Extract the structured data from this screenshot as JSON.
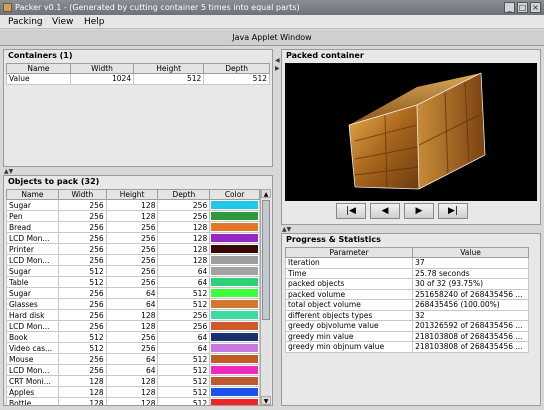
{
  "window": {
    "title": "Packer v0.1 - (Generated by cutting container 5 times into equal parts)",
    "min": "_",
    "max": "□",
    "close": "×"
  },
  "menu": [
    "Packing",
    "View",
    "Help"
  ],
  "applet_label": "Java Applet Window",
  "containers": {
    "title": "Containers (1)",
    "columns": [
      "Name",
      "Width",
      "Height",
      "Depth"
    ],
    "rows": [
      [
        "Value",
        "1024",
        "512",
        "512"
      ]
    ]
  },
  "objects": {
    "title": "Objects to pack (32)",
    "columns": [
      "Name",
      "Width",
      "Height",
      "Depth",
      "Color"
    ],
    "rows": [
      {
        "name": "Sugar",
        "w": "256",
        "h": "128",
        "d": "256",
        "color": "#1ec8e6"
      },
      {
        "name": "Pen",
        "w": "256",
        "h": "128",
        "d": "256",
        "color": "#2e9a3c"
      },
      {
        "name": "Bread",
        "w": "256",
        "h": "256",
        "d": "128",
        "color": "#e07828"
      },
      {
        "name": "LCD Mon...",
        "w": "256",
        "h": "256",
        "d": "128",
        "color": "#9628c8"
      },
      {
        "name": "Printer",
        "w": "256",
        "h": "256",
        "d": "128",
        "color": "#3a0606"
      },
      {
        "name": "LCD Mon...",
        "w": "256",
        "h": "256",
        "d": "128",
        "color": "#9e9e9e"
      },
      {
        "name": "Sugar",
        "w": "512",
        "h": "256",
        "d": "64",
        "color": "#a2a2a2"
      },
      {
        "name": "Table",
        "w": "512",
        "h": "256",
        "d": "64",
        "color": "#2ed078"
      },
      {
        "name": "Sugar",
        "w": "256",
        "h": "64",
        "d": "512",
        "color": "#3aff3a"
      },
      {
        "name": "Glasses",
        "w": "256",
        "h": "64",
        "d": "512",
        "color": "#d27830"
      },
      {
        "name": "Hard disk",
        "w": "256",
        "h": "128",
        "d": "256",
        "color": "#3adca0"
      },
      {
        "name": "LCD Mon...",
        "w": "256",
        "h": "128",
        "d": "256",
        "color": "#d05a2e"
      },
      {
        "name": "Book",
        "w": "512",
        "h": "256",
        "d": "64",
        "color": "#1a3070"
      },
      {
        "name": "Video cas...",
        "w": "512",
        "h": "256",
        "d": "64",
        "color": "#c878e0"
      },
      {
        "name": "Mouse",
        "w": "256",
        "h": "64",
        "d": "512",
        "color": "#c25a2a"
      },
      {
        "name": "LCD Mon...",
        "w": "256",
        "h": "64",
        "d": "512",
        "color": "#ee28c0"
      },
      {
        "name": "CRT Moni...",
        "w": "128",
        "h": "128",
        "d": "512",
        "color": "#be5a30"
      },
      {
        "name": "Apples",
        "w": "128",
        "h": "128",
        "d": "512",
        "color": "#1e50ee"
      },
      {
        "name": "Bottle",
        "w": "128",
        "h": "128",
        "d": "512",
        "color": "#ee2828"
      }
    ]
  },
  "packed": {
    "title": "Packed container",
    "buttons": {
      "first": "|◀",
      "prev": "◀",
      "next": "▶",
      "last": "▶|"
    }
  },
  "progress": {
    "title": "Progress & Statistics",
    "columns": [
      "Parameter",
      "Value"
    ],
    "rows": [
      [
        "Iteration",
        "37"
      ],
      [
        "Time",
        "25.78 seconds"
      ],
      [
        "packed objects",
        "30 of 32 (93.75%)"
      ],
      [
        "packed volume",
        "251658240 of 268435456 ..."
      ],
      [
        "total object volume",
        "268435456 (100.00%)"
      ],
      [
        "different objects types",
        "32"
      ],
      [
        "greedy objvolume value",
        "201326592 of 268435456 ..."
      ],
      [
        "greedy min value",
        "218103808 of 268435456 ..."
      ],
      [
        "greedy min objnum value",
        "218103808 of 268435456 ..."
      ]
    ]
  }
}
